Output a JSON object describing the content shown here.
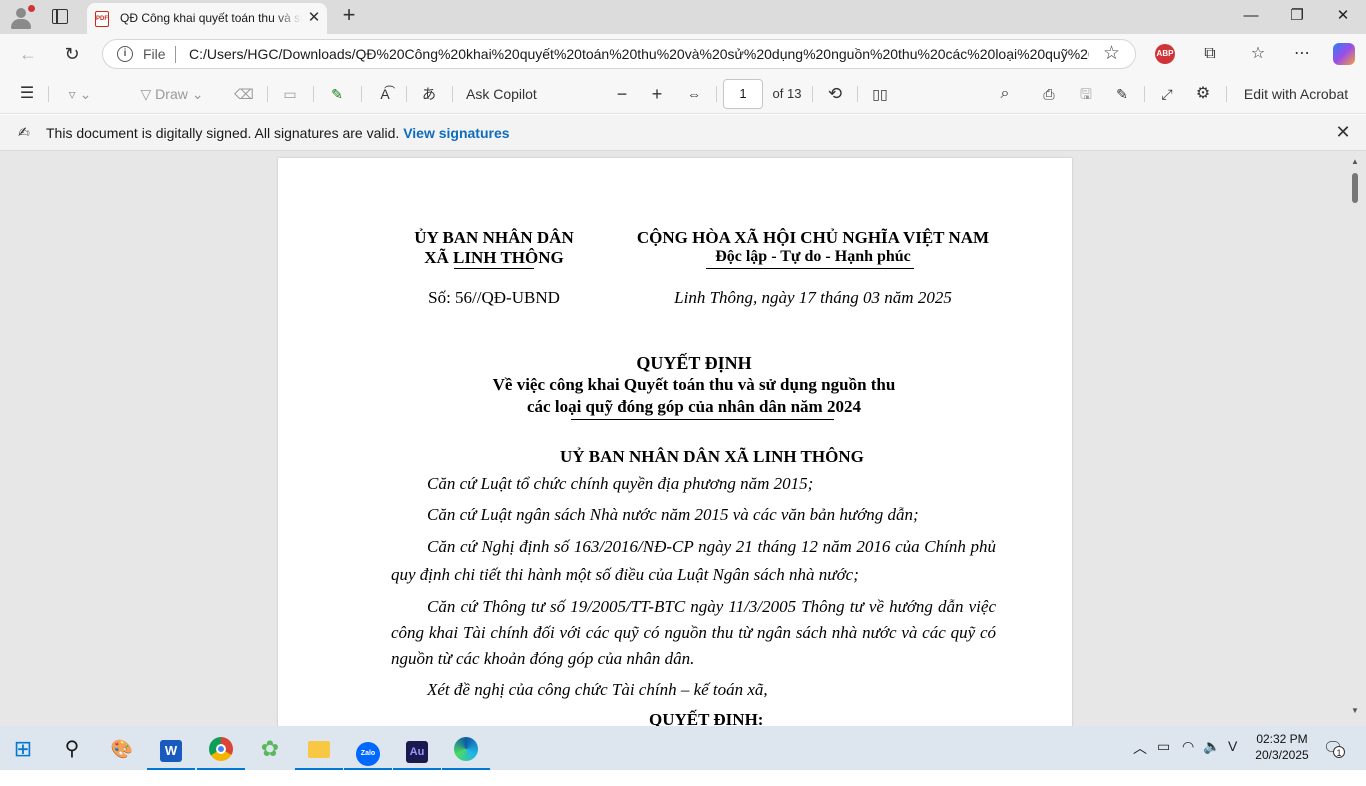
{
  "browser": {
    "tab_title": "QĐ Công khai quyết toán thu và sử dụng",
    "tab_icon": "pdf-icon",
    "address": {
      "scheme_label": "File",
      "url": "C:/Users/HGC/Downloads/QĐ%20Công%20khai%20quyết%20toán%20thu%20và%20sử%20dụng%20nguồn%20thu%20các%20loại%20quỹ%20..."
    },
    "extensions": [
      "ABP"
    ]
  },
  "pdf_toolbar": {
    "draw_label": "Draw",
    "ask_copilot": "Ask Copilot",
    "page_current": "1",
    "page_total": "of 13",
    "edit_acrobat": "Edit with Acrobat"
  },
  "infobar": {
    "message": "This document is digitally signed. All signatures are valid.",
    "link": "View signatures"
  },
  "document": {
    "org_line1": "ỦY BAN NHÂN DÂN",
    "org_line2": "XÃ LINH THÔNG",
    "nation_line1": "CỘNG HÒA XÃ HỘI CHỦ NGHĨA VIỆT NAM",
    "nation_line2": "Độc lập - Tự do - Hạnh phúc",
    "number": "Số: 56//QĐ-UBND",
    "place_date": "Linh Thông, ngày  17 tháng 03 năm 2025",
    "title": "QUYẾT ĐỊNH",
    "subject_line1": "Về việc công khai Quyết toán thu và sử dụng nguồn thu",
    "subject_line2": "các loại quỹ đóng góp của nhân dân năm 2024",
    "authority": "UỶ BAN NHÂN DÂN XÃ LINH THÔNG",
    "bases": [
      "Căn cứ Luật tổ chức chính quyền địa phương năm 2015;",
      "Căn cứ Luật ngân sách Nhà nước năm 2015 và các văn bản hướng dẫn;",
      "Căn cứ Nghị định số 163/2016/NĐ-CP ngày 21 tháng 12 năm 2016 của Chính phủ quy định chi tiết thi hành một số điều của Luật Ngân sách nhà nước;",
      "Căn cứ Thông tư số 19/2005/TT-BTC ngày 11/3/2005 Thông tư về hướng dẫn việc công khai Tài chính đối với các quỹ có nguồn thu từ ngân sách nhà nước và các quỹ có nguồn từ các khoản đóng góp của nhân dân.",
      "Xét đề nghị của công chức Tài chính – kế toán  xã,"
    ],
    "decides": "QUYẾT ĐỊNH:"
  },
  "taskbar": {
    "time": "02:32 PM",
    "date": "20/3/2025",
    "notification_count": "1",
    "apps": [
      "start-icon",
      "search-icon",
      "paint-icon",
      "word-icon",
      "chrome-icon",
      "app-green-icon",
      "file-explorer-icon",
      "zalo-icon",
      "audition-icon",
      "edge-icon"
    ]
  }
}
